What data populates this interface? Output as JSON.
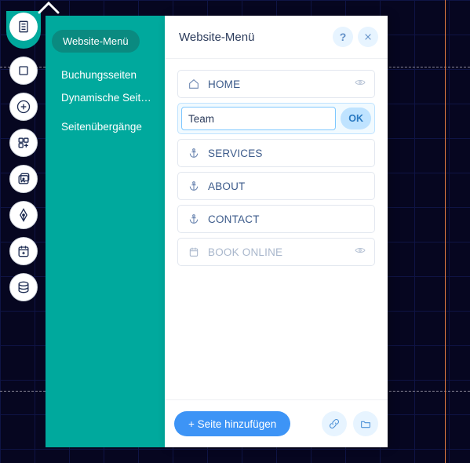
{
  "sidebar": {
    "items": [
      {
        "label": "Website-Menü",
        "active": true
      },
      {
        "label": "Buchungsseiten"
      },
      {
        "label": "Dynamische Seit…"
      },
      {
        "label": "Seitenübergänge"
      }
    ]
  },
  "panel": {
    "title": "Website-Menü"
  },
  "pages": [
    {
      "icon": "home",
      "label": "HOME",
      "hidden_icon": true
    },
    {
      "icon": "edit",
      "label": "Team",
      "editing": true,
      "ok_label": "OK"
    },
    {
      "icon": "anchor",
      "label": "SERVICES"
    },
    {
      "icon": "anchor",
      "label": "ABOUT"
    },
    {
      "icon": "anchor",
      "label": "CONTACT"
    },
    {
      "icon": "calendar",
      "label": "BOOK ONLINE",
      "hidden_icon": true,
      "dim": true
    }
  ],
  "footer": {
    "add_page_label": "+ Seite hinzufügen"
  },
  "rail_icons": [
    "pages",
    "section",
    "add",
    "grid",
    "media",
    "pen",
    "calendar",
    "database"
  ]
}
